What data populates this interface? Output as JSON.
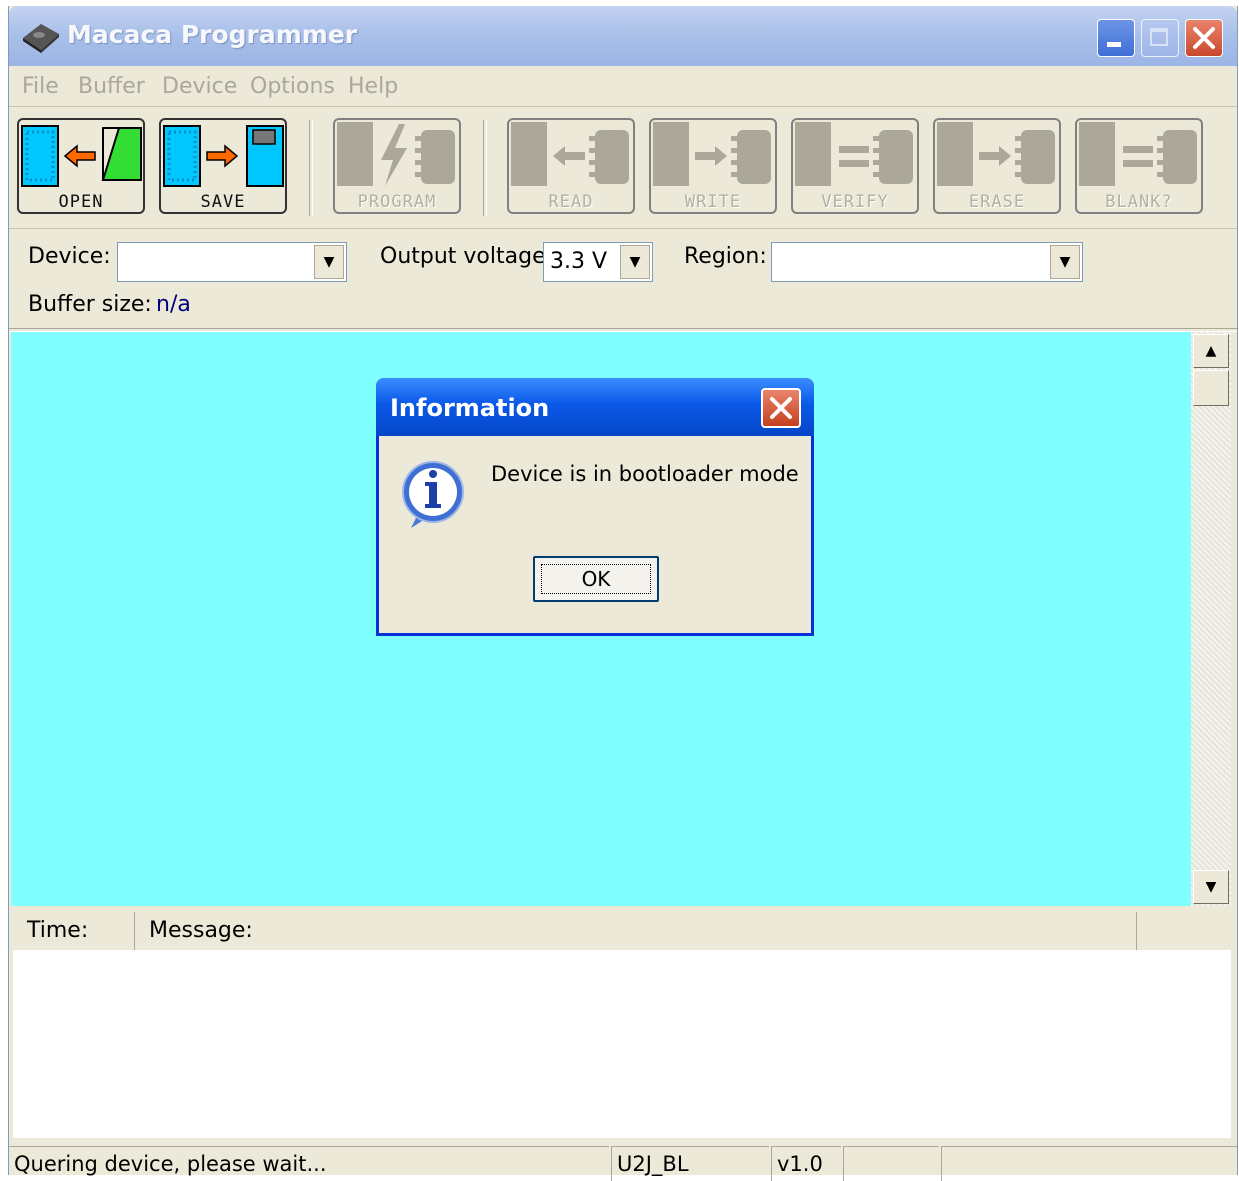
{
  "window": {
    "title": "Macaca Programmer"
  },
  "menu": [
    "File",
    "Buffer",
    "Device",
    "Options",
    "Help"
  ],
  "toolbar": {
    "open": "OPEN",
    "save": "SAVE",
    "program": "PROGRAM",
    "read": "READ",
    "write": "WRITE",
    "verify": "VERIFY",
    "erase": "ERASE",
    "blank": "BLANK?"
  },
  "settings": {
    "device_label": "Device:",
    "device_value": "",
    "voltage_label": "Output voltage:",
    "voltage_value": "3.3 V",
    "region_label": "Region:",
    "region_value": "",
    "buffer_label": "Buffer size:",
    "buffer_value": "n/a"
  },
  "log": {
    "col_time": "Time:",
    "col_message": "Message:"
  },
  "status": {
    "message": "Quering device, please wait...",
    "device_id": "U2J_BL",
    "version": "v1.0"
  },
  "dialog": {
    "title": "Information",
    "message": "Device is in bootloader mode",
    "ok_label": "OK"
  }
}
